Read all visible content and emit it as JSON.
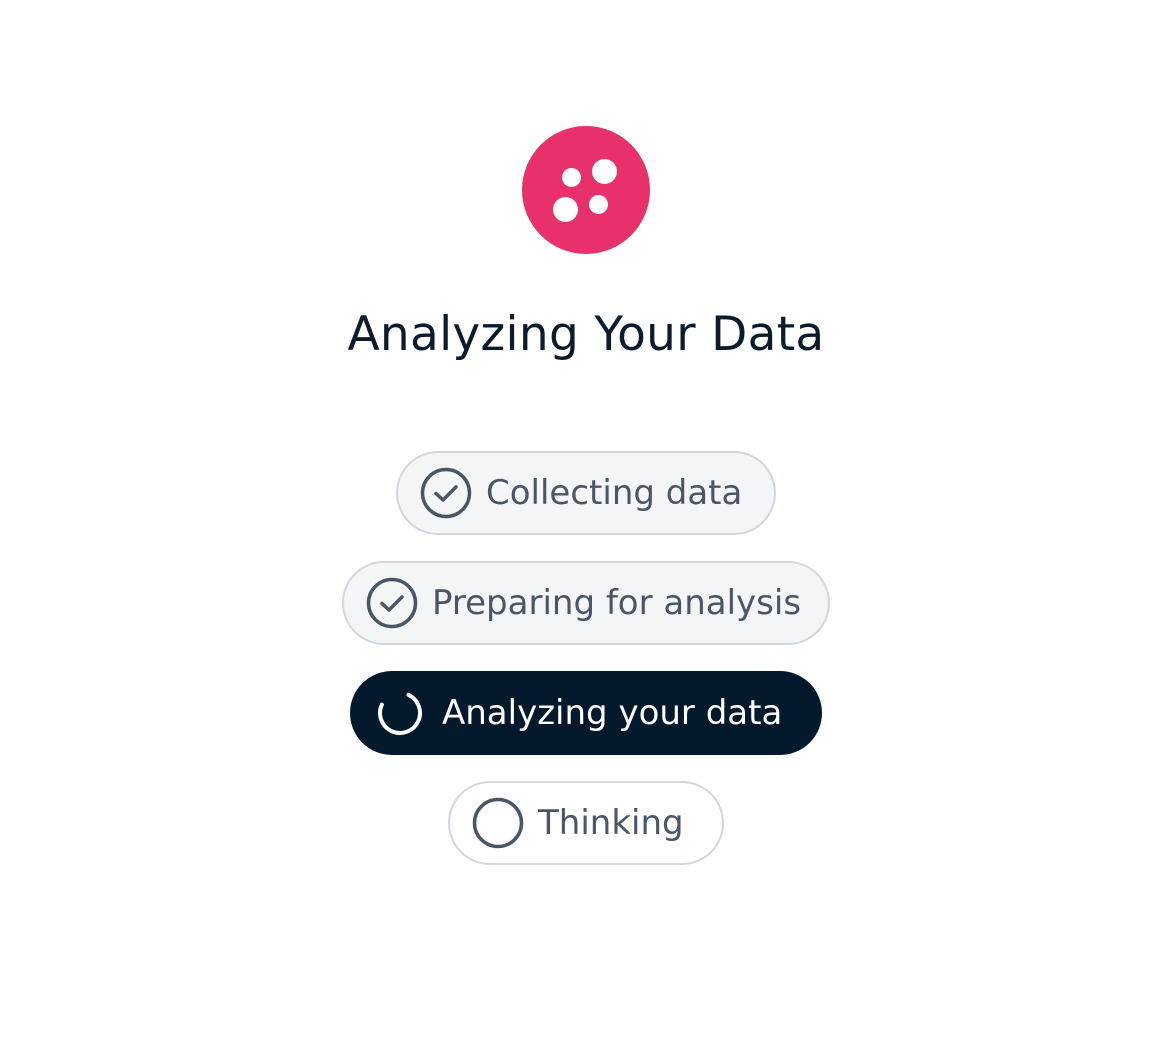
{
  "title": "Analyzing Your Data",
  "logo": {
    "icon": "dots-logo-icon",
    "color": "#e8316a"
  },
  "steps": [
    {
      "label": "Collecting data",
      "status": "complete",
      "icon": "check-circle-icon"
    },
    {
      "label": "Preparing for analysis",
      "status": "complete",
      "icon": "check-circle-icon"
    },
    {
      "label": "Analyzing your data",
      "status": "in-progress",
      "icon": "spinner-icon"
    },
    {
      "label": "Thinking",
      "status": "pending",
      "icon": "empty-circle-icon"
    }
  ],
  "colors": {
    "accent": "#e8316a",
    "active_background": "#04192b",
    "text_muted": "#4a5666",
    "title": "#0b1b2b"
  }
}
